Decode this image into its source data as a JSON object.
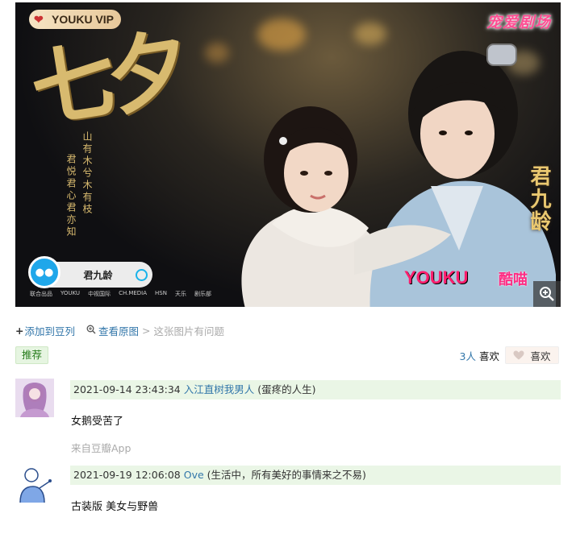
{
  "poster": {
    "vip_label": "YOUKU VIP",
    "channel_label": "宠爱剧场",
    "title_big": "七夕",
    "poem_line1": "山有木兮木有枝",
    "poem_line2": "君悦君心君亦知",
    "side_title": "君九龄",
    "search_text": "君九龄",
    "partners": [
      "联合出品",
      "YOUKU",
      "中视国际",
      "CH.MEDIA",
      "HSN",
      "天乐",
      "剧乐部"
    ],
    "youku_logo": "YOUKU",
    "kumiao_logo": "酷喵"
  },
  "actions": {
    "add_to_doulist": "添加到豆列",
    "view_original": "查看原图",
    "separator": ">",
    "report": "这张图片有问题"
  },
  "tag": "推荐",
  "likes": {
    "count": "3人",
    "suffix": "喜欢",
    "button_label": "喜欢"
  },
  "comments": [
    {
      "timestamp": "2021-09-14 23:43:34",
      "author": "入江直树我男人",
      "author_note": "(蛋疼的人生)",
      "text": "女鹅受苦了",
      "source": "来自豆瓣App"
    },
    {
      "timestamp": "2021-09-19 12:06:08",
      "author": "Ove",
      "author_note": "(生活中，所有美好的事情来之不易)",
      "text": "古装版 美女与野兽"
    }
  ],
  "colors": {
    "link": "#3377aa",
    "tag_bg": "#e6f5e1",
    "tag_text": "#267c1b",
    "comment_head_bg": "#eaf6e6",
    "muted": "#aaaaaa"
  }
}
